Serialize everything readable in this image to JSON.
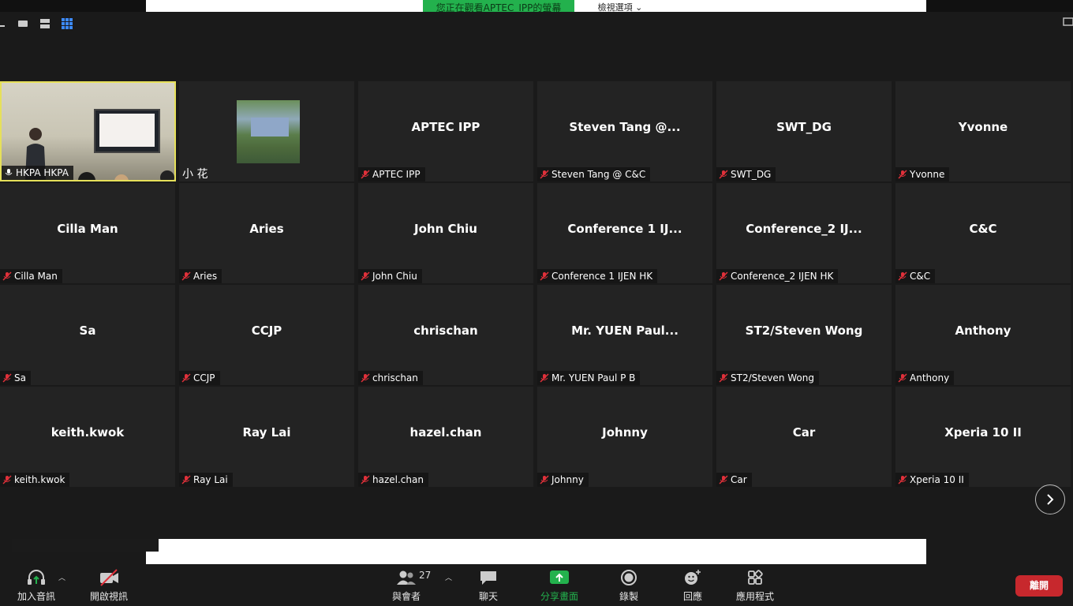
{
  "top": {
    "banner": "您正在觀看APTEC_IPP的螢幕",
    "view_options": "檢視選項 ⌄"
  },
  "tiles": [
    {
      "display": "",
      "label": "HKPA HKPA",
      "video": "room"
    },
    {
      "display": "",
      "label": "小 花",
      "video": "photo"
    },
    {
      "display": "APTEC IPP",
      "label": "APTEC IPP"
    },
    {
      "display": "Steven Tang @...",
      "label": "Steven Tang @ C&C"
    },
    {
      "display": "SWT_DG",
      "label": "SWT_DG"
    },
    {
      "display": "Yvonne",
      "label": "Yvonne"
    },
    {
      "display": "Cilla Man",
      "label": "Cilla Man"
    },
    {
      "display": "Aries",
      "label": "Aries"
    },
    {
      "display": "John Chiu",
      "label": "John Chiu"
    },
    {
      "display": "Conference 1 IJ...",
      "label": "Conference 1 IJEN HK"
    },
    {
      "display": "Conference_2 IJ...",
      "label": "Conference_2 IJEN HK"
    },
    {
      "display": "C&C",
      "label": "C&C"
    },
    {
      "display": "Sa",
      "label": "Sa"
    },
    {
      "display": "CCJP",
      "label": "CCJP"
    },
    {
      "display": "chrischan",
      "label": "chrischan"
    },
    {
      "display": "Mr. YUEN Paul...",
      "label": "Mr. YUEN Paul P B"
    },
    {
      "display": "ST2/Steven Wong",
      "label": "ST2/Steven Wong"
    },
    {
      "display": "Anthony",
      "label": "Anthony"
    },
    {
      "display": "keith.kwok",
      "label": "keith.kwok"
    },
    {
      "display": "Ray Lai",
      "label": "Ray Lai"
    },
    {
      "display": "hazel.chan",
      "label": "hazel.chan"
    },
    {
      "display": "Johnny",
      "label": "Johnny"
    },
    {
      "display": "Car",
      "label": "Car"
    },
    {
      "display": "Xperia 10 II",
      "label": "Xperia 10 II"
    }
  ],
  "toolbar": {
    "join_audio": "加入音訊",
    "start_video": "開啟視訊",
    "participants": "與會者",
    "participants_count": "27",
    "chat": "聊天",
    "share_screen": "分享畫面",
    "record": "錄製",
    "reactions": "回應",
    "apps": "應用程式",
    "leave": "離開"
  },
  "colors": {
    "share_green": "#23b14d",
    "leave_red": "#c7282d",
    "active_speaker": "#e6e05a",
    "mute_red": "#e0303a"
  }
}
